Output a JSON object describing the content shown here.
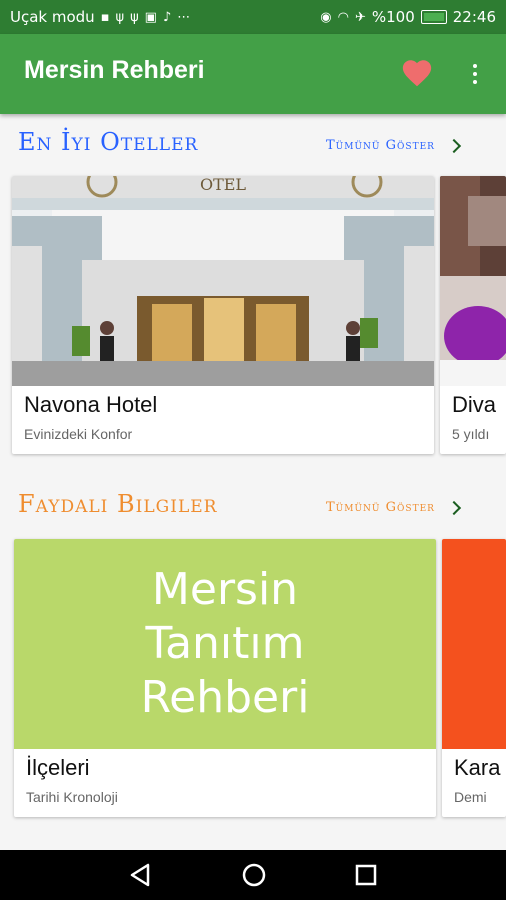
{
  "status": {
    "left_text": "Uçak modu",
    "battery": "%100",
    "time": "22:46"
  },
  "appbar": {
    "title": "Mersin Rehberi",
    "heart_icon": "heart-icon",
    "more_icon": "more-vert-icon"
  },
  "hotels": {
    "title": "En İyi Oteller",
    "show_all": "Tümünü Göster",
    "color": "#2962ff",
    "cards": [
      {
        "name": "Navona Hotel",
        "subtitle": "Evinizdeki Konfor",
        "sign": "OTEL"
      },
      {
        "name": "Diva",
        "subtitle": "5 yıldı"
      }
    ]
  },
  "info": {
    "title": "Faydalı Bilgiler",
    "show_all": "Tümünü Göster",
    "color": "#ef8d2f",
    "cards": [
      {
        "name": "İlçeleri",
        "subtitle": "Tarihi Kronoloji",
        "banner_lines": [
          "Mersin",
          "Tanıtım",
          "Rehberi"
        ],
        "banner_color": "#b9d86a"
      },
      {
        "name": "Kara",
        "subtitle": "Demi",
        "banner_color": "#f4511e"
      }
    ]
  },
  "colors": {
    "status_bar": "#2e7d32",
    "app_bar": "#43a047",
    "heart": "#ef6d6d"
  }
}
